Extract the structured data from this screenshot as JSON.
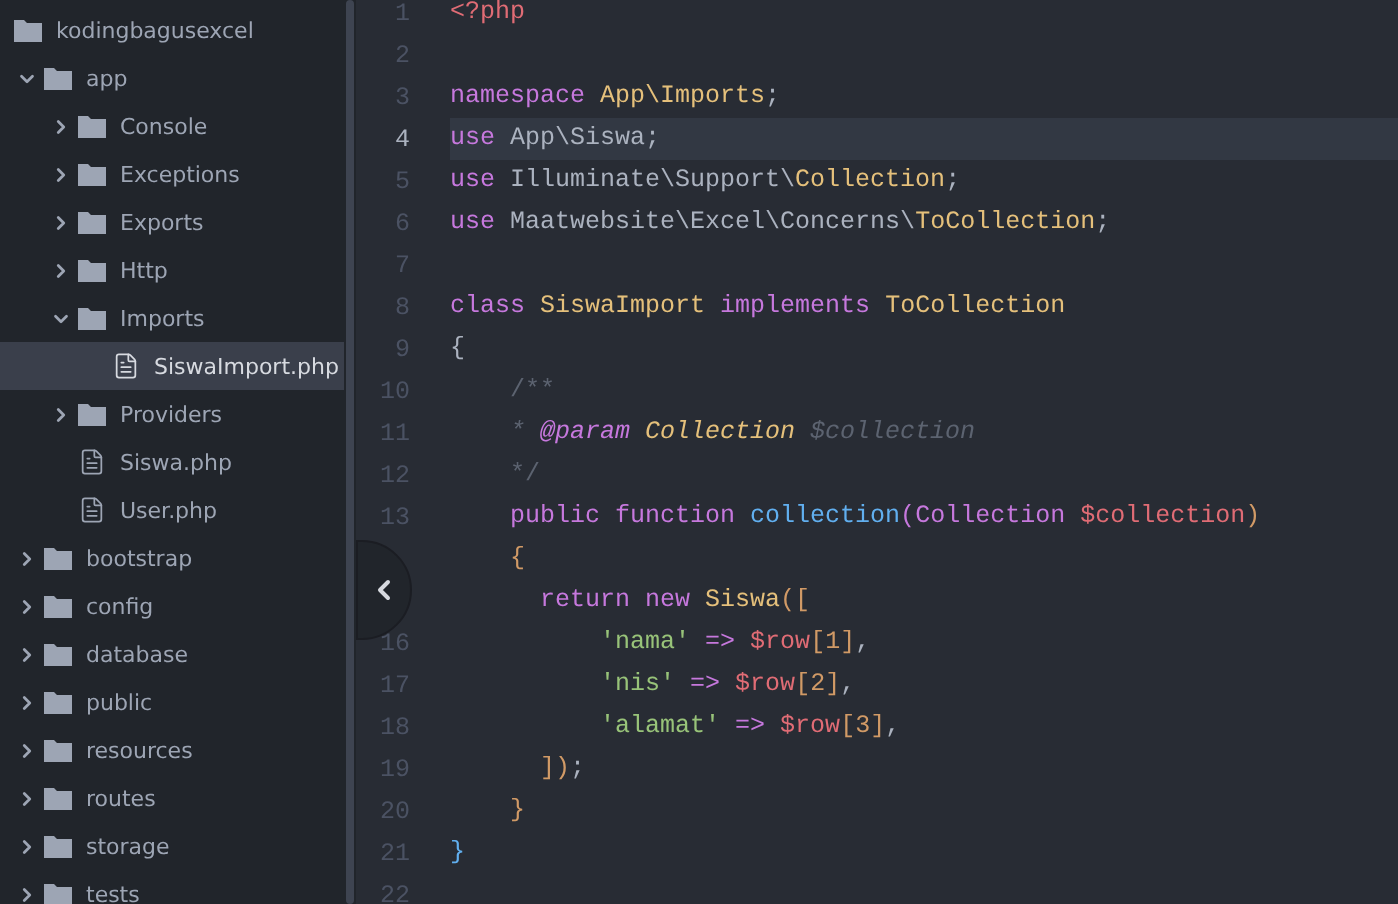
{
  "sidebar": {
    "root": {
      "name": "kodingbagusexcel"
    },
    "items": [
      {
        "name": "app",
        "kind": "folder",
        "expanded": true,
        "selected": false,
        "children": [
          {
            "name": "Console",
            "kind": "folder",
            "expanded": false,
            "selected": false
          },
          {
            "name": "Exceptions",
            "kind": "folder",
            "expanded": false,
            "selected": false
          },
          {
            "name": "Exports",
            "kind": "folder",
            "expanded": false,
            "selected": false
          },
          {
            "name": "Http",
            "kind": "folder",
            "expanded": false,
            "selected": false
          },
          {
            "name": "Imports",
            "kind": "folder",
            "expanded": true,
            "selected": false,
            "children": [
              {
                "name": "SiswaImport.php",
                "kind": "file",
                "selected": true
              }
            ]
          },
          {
            "name": "Providers",
            "kind": "folder",
            "expanded": false,
            "selected": false
          },
          {
            "name": "Siswa.php",
            "kind": "file",
            "selected": false
          },
          {
            "name": "User.php",
            "kind": "file",
            "selected": false
          }
        ]
      },
      {
        "name": "bootstrap",
        "kind": "folder",
        "expanded": false,
        "selected": false
      },
      {
        "name": "config",
        "kind": "folder",
        "expanded": false,
        "selected": false
      },
      {
        "name": "database",
        "kind": "folder",
        "expanded": false,
        "selected": false
      },
      {
        "name": "public",
        "kind": "folder",
        "expanded": false,
        "selected": false
      },
      {
        "name": "resources",
        "kind": "folder",
        "expanded": false,
        "selected": false
      },
      {
        "name": "routes",
        "kind": "folder",
        "expanded": false,
        "selected": false
      },
      {
        "name": "storage",
        "kind": "folder",
        "expanded": false,
        "selected": false
      },
      {
        "name": "tests",
        "kind": "folder",
        "expanded": false,
        "selected": false
      }
    ]
  },
  "editor": {
    "lines": [
      {
        "number": "1",
        "current": false,
        "tokens": [
          {
            "text": "<?php",
            "kind": "tag"
          }
        ]
      },
      {
        "number": "2",
        "current": false
      },
      {
        "number": "3",
        "current": false,
        "tokens": [
          {
            "text": "namespace",
            "kind": "keyword"
          },
          {
            "text": " App\\Imports",
            "kind": "class"
          },
          {
            "text": ";",
            "kind": "plain"
          }
        ]
      },
      {
        "number": "4",
        "current": true,
        "tokens": [
          {
            "text": "use",
            "kind": "keyword"
          },
          {
            "text": " App\\Siswa;",
            "kind": "plain"
          }
        ]
      },
      {
        "number": "5",
        "current": false,
        "tokens": [
          {
            "text": "use",
            "kind": "keyword"
          },
          {
            "text": " Illuminate\\Support\\",
            "kind": "plain"
          },
          {
            "text": "Collection",
            "kind": "class"
          },
          {
            "text": ";",
            "kind": "plain"
          }
        ]
      },
      {
        "number": "6",
        "current": false,
        "tokens": [
          {
            "text": "use",
            "kind": "keyword"
          },
          {
            "text": " Maatwebsite\\Excel\\Concerns\\",
            "kind": "plain"
          },
          {
            "text": "ToCollection",
            "kind": "class"
          },
          {
            "text": ";",
            "kind": "plain"
          }
        ]
      },
      {
        "number": "7",
        "current": false
      },
      {
        "number": "8",
        "current": false,
        "tokens": [
          {
            "text": "class",
            "kind": "keyword"
          },
          {
            "text": " SiswaImport ",
            "kind": "class"
          },
          {
            "text": "implements",
            "kind": "keyword"
          },
          {
            "text": " ToCollection",
            "kind": "class"
          }
        ]
      },
      {
        "number": "9",
        "current": false,
        "tokens": [
          {
            "text": "{",
            "kind": "plain"
          }
        ]
      },
      {
        "number": "10",
        "current": false,
        "tokens": [
          {
            "text": "    /**",
            "kind": "comment"
          }
        ]
      },
      {
        "number": "11",
        "current": false,
        "tokens": [
          {
            "text": "    * ",
            "kind": "comment"
          },
          {
            "text": "@param",
            "kind": "doctag"
          },
          {
            "text": " Collection",
            "kind": "doctype"
          },
          {
            "text": " $collection",
            "kind": "comment"
          }
        ]
      },
      {
        "number": "12",
        "current": false,
        "tokens": [
          {
            "text": "    */",
            "kind": "comment"
          }
        ]
      },
      {
        "number": "13",
        "current": false,
        "tokens": [
          {
            "text": "    public function ",
            "kind": "keyword"
          },
          {
            "text": "collection",
            "kind": "function"
          },
          {
            "text": "(",
            "kind": "keyword"
          },
          {
            "text": "Collection ",
            "kind": "keyword"
          },
          {
            "text": "$collection",
            "kind": "variable"
          },
          {
            "text": ")",
            "kind": "number"
          }
        ]
      },
      {
        "current": false,
        "tokens": [
          {
            "text": "    {",
            "kind": "number"
          }
        ]
      },
      {
        "current": false,
        "tokens": [
          {
            "text": "      return new ",
            "kind": "keyword"
          },
          {
            "text": "Siswa",
            "kind": "class"
          },
          {
            "text": "([",
            "kind": "number"
          }
        ]
      },
      {
        "number": "16",
        "current": false,
        "tokens": [
          {
            "text": "          'nama'",
            "kind": "string"
          },
          {
            "text": " => ",
            "kind": "keyword"
          },
          {
            "text": "$row",
            "kind": "variable"
          },
          {
            "text": "[1]",
            "kind": "number"
          },
          {
            "text": ",",
            "kind": "plain"
          }
        ]
      },
      {
        "number": "17",
        "current": false,
        "tokens": [
          {
            "text": "          'nis'",
            "kind": "string"
          },
          {
            "text": " => ",
            "kind": "keyword"
          },
          {
            "text": "$row",
            "kind": "variable"
          },
          {
            "text": "[2]",
            "kind": "number"
          },
          {
            "text": ",",
            "kind": "plain"
          }
        ]
      },
      {
        "number": "18",
        "current": false,
        "tokens": [
          {
            "text": "          'alamat'",
            "kind": "string"
          },
          {
            "text": " => ",
            "kind": "keyword"
          },
          {
            "text": "$row",
            "kind": "variable"
          },
          {
            "text": "[3]",
            "kind": "number"
          },
          {
            "text": ",",
            "kind": "plain"
          }
        ]
      },
      {
        "number": "19",
        "current": false,
        "tokens": [
          {
            "text": "      ])",
            "kind": "number"
          },
          {
            "text": ";",
            "kind": "plain"
          }
        ]
      },
      {
        "number": "20",
        "current": false,
        "tokens": [
          {
            "text": "    }",
            "kind": "number"
          }
        ]
      },
      {
        "number": "21",
        "current": false,
        "tokens": [
          {
            "text": "}",
            "kind": "function"
          }
        ]
      },
      {
        "number": "22",
        "current": false
      }
    ]
  }
}
